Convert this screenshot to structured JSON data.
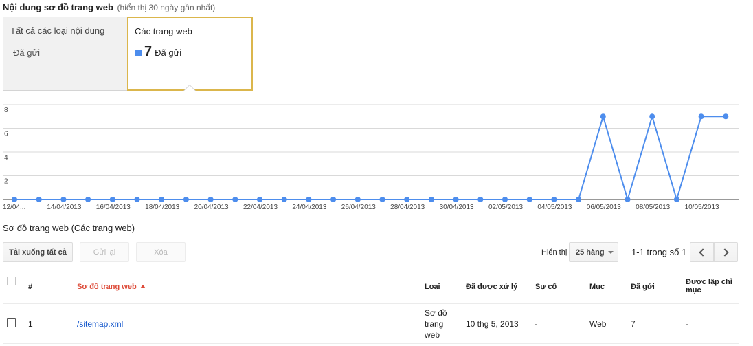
{
  "header": {
    "title": "Nội dung sơ đồ trang web",
    "subtitle": "(hiển thị 30 ngày gần nhất)"
  },
  "tabs": [
    {
      "label": "Tất cả các loại nội dung",
      "sub_label": "Đã gửi"
    },
    {
      "label": "Các trang web",
      "count": "7",
      "sub_label": "Đã gửi"
    }
  ],
  "colors": {
    "series": "#4d8ded",
    "active_tab_border": "#dbb64c",
    "sort_header": "#dd4b39",
    "link": "#1155cc"
  },
  "chart_data": {
    "type": "line",
    "series": [
      {
        "name": "Đã gửi",
        "values": [
          0,
          0,
          0,
          0,
          0,
          0,
          0,
          0,
          0,
          0,
          0,
          0,
          0,
          0,
          0,
          0,
          0,
          0,
          0,
          0,
          0,
          0,
          0,
          0,
          7,
          0,
          7,
          0,
          7,
          7
        ]
      }
    ],
    "x_tick_labels": [
      "12/04...",
      "14/04/2013",
      "16/04/2013",
      "18/04/2013",
      "20/04/2013",
      "22/04/2013",
      "24/04/2013",
      "26/04/2013",
      "28/04/2013",
      "30/04/2013",
      "02/05/2013",
      "04/05/2013",
      "06/05/2013",
      "08/05/2013",
      "10/05/2013"
    ],
    "y_ticks": [
      2,
      4,
      6,
      8
    ],
    "ylim": [
      0,
      8
    ],
    "grid": true,
    "legend": "none"
  },
  "table_section": {
    "title": "Sơ đồ trang web (Các trang web)",
    "buttons": {
      "download_all": "Tải xuống tất cả",
      "resend": "Gửi lại",
      "delete": "Xóa"
    },
    "show_label": "Hiển thị",
    "rows_per_page": "25 hàng",
    "page_info": "1-1 trong số 1",
    "columns": {
      "num": "#",
      "sitemap": "Sơ đồ trang web",
      "type": "Loại",
      "processed": "Đã được xử lý",
      "issues": "Sự cố",
      "item": "Mục",
      "submitted": "Đã gửi",
      "indexed_l1": "Được lập chỉ",
      "indexed_l2": "mục"
    },
    "rows": [
      {
        "num": "1",
        "sitemap": "/sitemap.xml",
        "type_l1": "Sơ đồ",
        "type_l2": "trang",
        "type_l3": "web",
        "processed": "10 thg 5, 2013",
        "issues": "-",
        "item": "Web",
        "submitted": "7",
        "indexed": "-"
      }
    ]
  }
}
